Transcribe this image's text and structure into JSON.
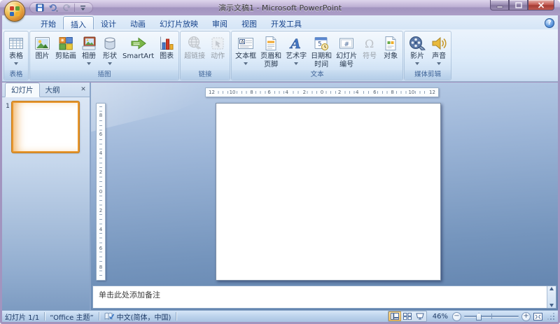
{
  "window": {
    "title": "演示文稿1 - Microsoft PowerPoint"
  },
  "tabs": [
    {
      "label": "开始"
    },
    {
      "label": "插入"
    },
    {
      "label": "设计"
    },
    {
      "label": "动画"
    },
    {
      "label": "幻灯片放映"
    },
    {
      "label": "审阅"
    },
    {
      "label": "视图"
    },
    {
      "label": "开发工具"
    }
  ],
  "ribbon": {
    "groups": [
      {
        "label": "表格",
        "buttons": [
          {
            "label": "表格"
          }
        ]
      },
      {
        "label": "插图",
        "buttons": [
          {
            "label": "图片"
          },
          {
            "label": "剪贴画"
          },
          {
            "label": "相册"
          },
          {
            "label": "形状"
          },
          {
            "label": "SmartArt"
          },
          {
            "label": "图表"
          }
        ]
      },
      {
        "label": "链接",
        "buttons": [
          {
            "label": "超链接"
          },
          {
            "label": "动作"
          }
        ]
      },
      {
        "label": "文本",
        "buttons": [
          {
            "label": "文本框"
          },
          {
            "label": "页眉和",
            "label2": "页脚"
          },
          {
            "label": "艺术字"
          },
          {
            "label": "日期和",
            "label2": "时间"
          },
          {
            "label": "幻灯片",
            "label2": "编号"
          },
          {
            "label": "符号"
          },
          {
            "label": "对象"
          }
        ]
      },
      {
        "label": "媒体剪辑",
        "buttons": [
          {
            "label": "影片"
          },
          {
            "label": "声音"
          }
        ]
      }
    ]
  },
  "panel": {
    "tabs": [
      {
        "label": "幻灯片"
      },
      {
        "label": "大纲"
      }
    ],
    "slide_number": "1"
  },
  "rulers": {
    "horizontal": [
      "12",
      "10",
      "8",
      "6",
      "4",
      "2",
      "0",
      "2",
      "4",
      "6",
      "8",
      "10",
      "12"
    ],
    "vertical": [
      "8",
      "6",
      "4",
      "2",
      "0",
      "2",
      "4",
      "6",
      "8"
    ]
  },
  "notes": {
    "placeholder": "单击此处添加备注"
  },
  "status": {
    "slide": "幻灯片 1/1",
    "theme": "“Office 主题”",
    "language": "中文(简体，中国)",
    "zoom": "46%"
  },
  "colors": {
    "selection_orange": "#e8972e",
    "titlebar_purple": "#a294bf",
    "ribbon_blue": "#dcebfa"
  }
}
